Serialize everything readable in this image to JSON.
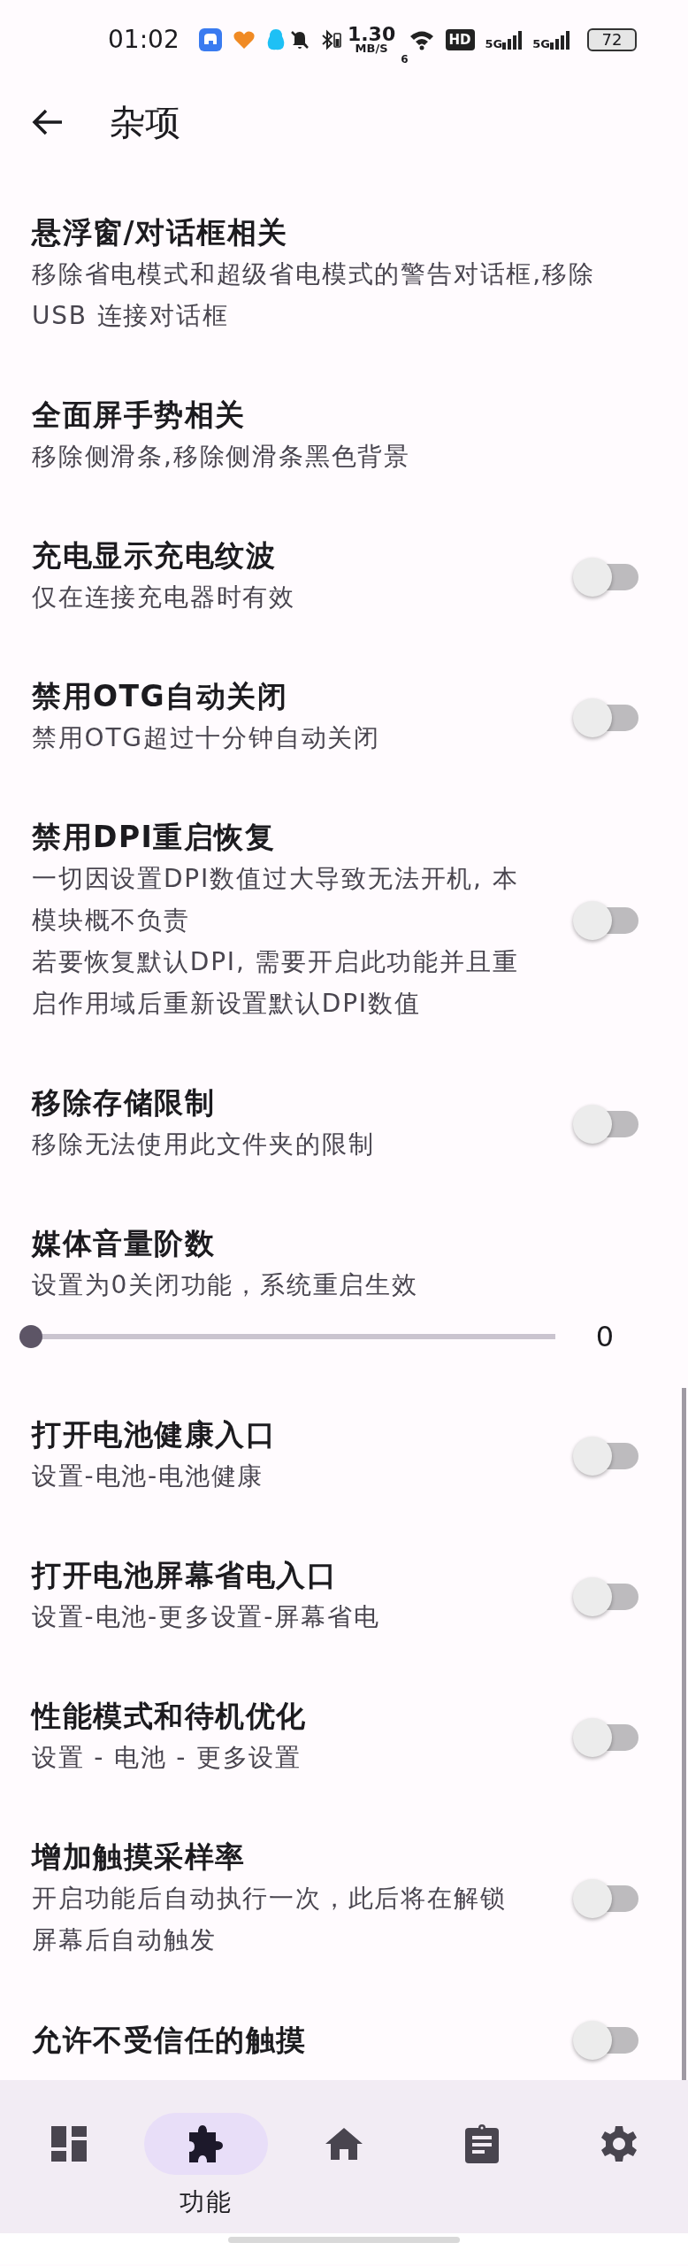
{
  "status_bar": {
    "time": "01:02",
    "net_speed": "1.30",
    "net_speed_unit": "MB/S",
    "wifi_label": "6",
    "hd_label": "HD",
    "signals": [
      {
        "label": "5G"
      },
      {
        "label": "5G"
      }
    ],
    "battery": "72"
  },
  "app_bar": {
    "title": "杂项"
  },
  "items": [
    {
      "kind": "text",
      "title": "悬浮窗/对话框相关",
      "subtitle": "移除省电模式和超级省电模式的警告对话框,移除USB 连接对话框"
    },
    {
      "kind": "text",
      "title": "全面屏手势相关",
      "subtitle": "移除侧滑条,移除侧滑条黑色背景"
    },
    {
      "kind": "switch",
      "title": "充电显示充电纹波",
      "subtitle": "仅在连接充电器时有效",
      "checked": false
    },
    {
      "kind": "switch",
      "title": "禁用OTG自动关闭",
      "subtitle": "禁用OTG超过十分钟自动关闭",
      "checked": false
    },
    {
      "kind": "switch",
      "title": "禁用DPI重启恢复",
      "subtitle": [
        "一切因设置DPI数值过大导致无法开机, 本模块概不负责",
        "若要恢复默认DPI, 需要开启此功能并且重启作用域后重新设置默认DPI数值"
      ],
      "checked": false
    },
    {
      "kind": "switch",
      "title": "移除存储限制",
      "subtitle": "移除无法使用此文件夹的限制",
      "checked": false
    },
    {
      "kind": "slider",
      "title": "媒体音量阶数",
      "subtitle": "设置为0关闭功能，系统重启生效",
      "level": 0,
      "reading": "0"
    },
    {
      "kind": "switch",
      "title": "打开电池健康入口",
      "subtitle": "设置-电池-电池健康",
      "checked": false
    },
    {
      "kind": "switch",
      "title": "打开电池屏幕省电入口",
      "subtitle": "设置-电池-更多设置-屏幕省电",
      "checked": false
    },
    {
      "kind": "switch",
      "title": "性能模式和待机优化",
      "subtitle": "设置 - 电池 - 更多设置",
      "checked": false
    },
    {
      "kind": "switch",
      "title": "增加触摸采样率",
      "subtitle": "开启功能后自动执行一次，此后将在解锁屏幕后自动触发",
      "checked": false
    },
    {
      "kind": "switch",
      "title": "允许不受信任的触摸",
      "checked": false
    }
  ],
  "nav": [
    {
      "selected": false
    },
    {
      "label": "功能",
      "selected": true
    },
    {
      "selected": false
    },
    {
      "selected": false
    },
    {
      "selected": false
    }
  ]
}
